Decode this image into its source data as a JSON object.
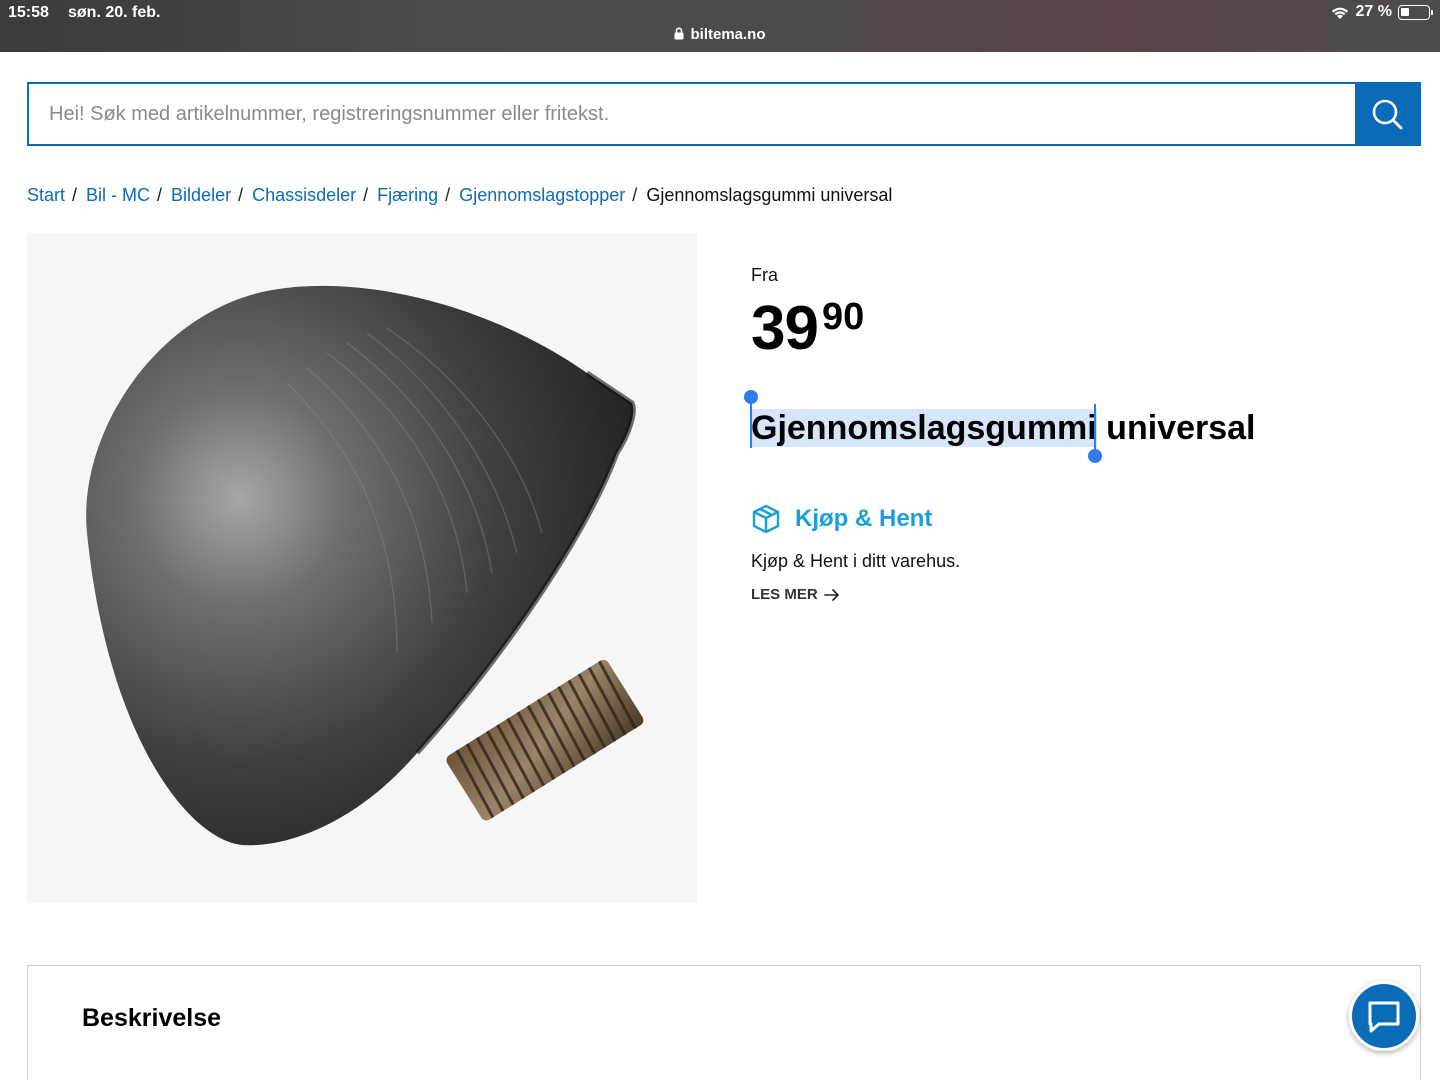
{
  "status_bar": {
    "time": "15:58",
    "date": "søn. 20. feb.",
    "battery": "27 %",
    "battery_level": 0.27,
    "url": "biltema.no"
  },
  "search": {
    "placeholder": "Hei! Søk med artikelnummer, registreringsnummer eller fritekst.",
    "icon": "search-icon"
  },
  "breadcrumb": {
    "items": [
      "Start",
      "Bil - MC",
      "Bildeler",
      "Chassisdeler",
      "Fjæring",
      "Gjennomslagstopper"
    ],
    "separator": "/",
    "current": "Gjennomslagsgummi universal"
  },
  "product": {
    "price_prefix": "Fra",
    "price_whole": "39",
    "price_decimal": "90",
    "title_selected": "Gjennomslagsgummi",
    "title_rest": " universal"
  },
  "kjop_hent": {
    "icon": "box-icon",
    "title": "Kjøp & Hent",
    "text": "Kjøp & Hent i ditt varehus.",
    "link": "LES MER"
  },
  "description": {
    "heading": "Beskrivelse"
  },
  "colors": {
    "brand_blue": "#0a6cb8",
    "accent_cyan": "#1aa0d8",
    "selection": "#d7e5fb"
  }
}
